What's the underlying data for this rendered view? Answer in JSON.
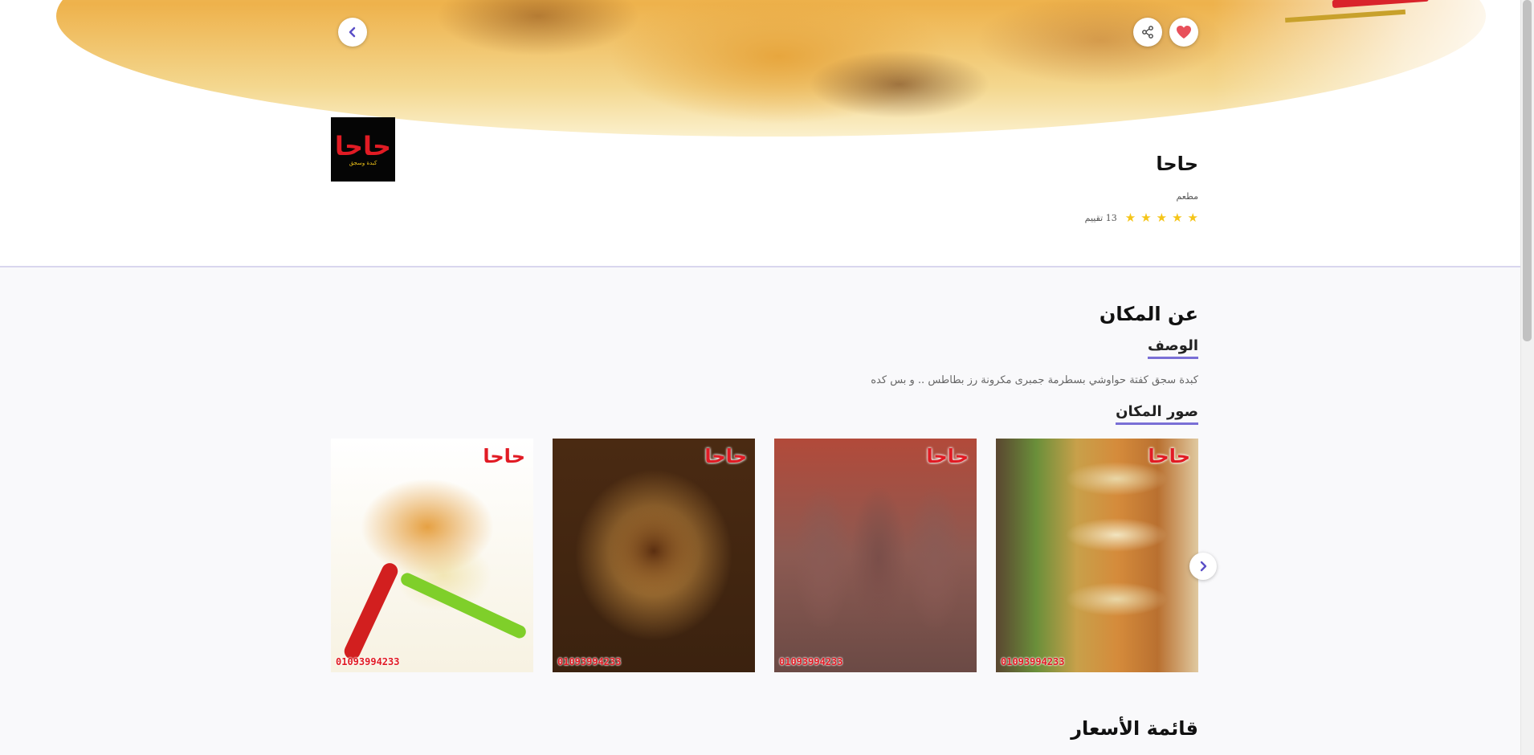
{
  "place": {
    "name": "حاحا",
    "type": "مطعم",
    "rating_stars": 5,
    "rating_text": "13 تقييم"
  },
  "logo": {
    "main": "حاحا",
    "sub": "كبدة وسجق"
  },
  "hero": {
    "back_icon": "chevron-left-icon",
    "share_icon": "share-icon",
    "favorite_icon": "heart-icon"
  },
  "about": {
    "title": "عن المكان",
    "description_title": "الوصف",
    "description": "كبدة سجق كفتة حواوشي بسطرمة جمبرى مكرونة رز بطاطس .. و بس كده",
    "photos_title": "صور المكان"
  },
  "photos": [
    {
      "brand": "حاحا",
      "phone": "01093994233"
    },
    {
      "brand": "حاحا",
      "phone": "01093994233"
    },
    {
      "brand": "حاحا",
      "phone": "01093994233"
    },
    {
      "brand": "حاحا",
      "phone": "01093994233"
    }
  ],
  "carousel": {
    "next_icon": "chevron-right-icon"
  },
  "menu": {
    "title": "قائمة الأسعار"
  },
  "colors": {
    "accent": "#7a6fd6",
    "star": "#f5c518",
    "favorite": "#e8505b",
    "brand_red": "#e11b24"
  }
}
